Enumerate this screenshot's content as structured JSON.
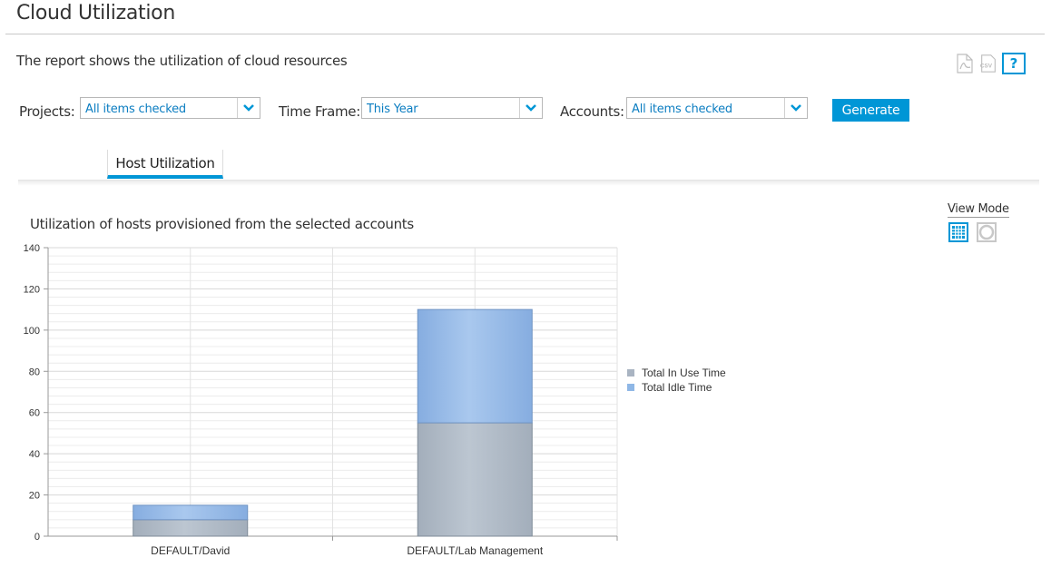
{
  "page": {
    "title": "Cloud Utilization",
    "description": "The report shows the utilization of cloud resources"
  },
  "toolbar": {
    "pdf_icon": "pdf-export-icon",
    "csv_icon": "csv-export-icon",
    "help_label": "?"
  },
  "filters": {
    "projects_label": "Projects:",
    "projects_value": "All items checked",
    "timeframe_label": "Time Frame:",
    "timeframe_value": "This Year",
    "accounts_label": "Accounts:",
    "accounts_value": "All items checked",
    "generate_label": "Generate"
  },
  "tabs": [
    {
      "label": "Host Utilization",
      "active": true
    }
  ],
  "view_mode": {
    "label": "View Mode",
    "options": [
      "grid-view-icon",
      "pie-view-icon"
    ],
    "selected": "grid-view-icon"
  },
  "colors": {
    "accent": "#0096d6",
    "in_use": "#a9b4c2",
    "idle": "#8fb7e6"
  },
  "chart_data": {
    "type": "bar",
    "stacked": true,
    "title": "Utilization of hosts provisioned from the selected accounts",
    "categories": [
      "DEFAULT/David",
      "DEFAULT/Lab Management"
    ],
    "series": [
      {
        "name": "Total In Use Time",
        "values": [
          8,
          55
        ]
      },
      {
        "name": "Total Idle Time",
        "values": [
          7,
          55
        ]
      }
    ],
    "ylim": [
      0,
      140
    ],
    "yticks": [
      0,
      20,
      40,
      60,
      80,
      100,
      120,
      140
    ],
    "grid": true,
    "legend": "right"
  }
}
